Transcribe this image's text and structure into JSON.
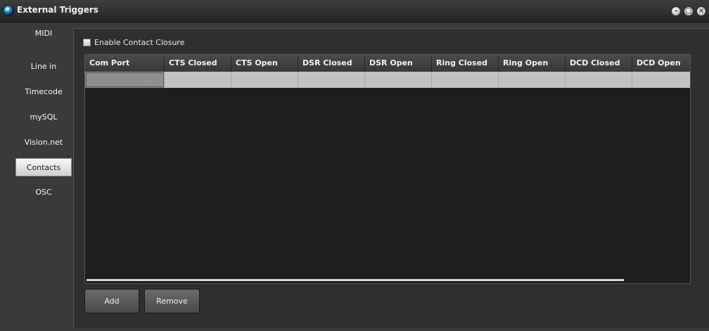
{
  "window": {
    "title": "External Triggers"
  },
  "sidebar": {
    "items": [
      {
        "label": "MIDI",
        "active": false
      },
      {
        "label": "Line in",
        "active": false
      },
      {
        "label": "Timecode",
        "active": false
      },
      {
        "label": "mySQL",
        "active": false
      },
      {
        "label": "Vision.net",
        "active": false
      },
      {
        "label": "Contacts",
        "active": true
      },
      {
        "label": "OSC",
        "active": false
      }
    ]
  },
  "contacts": {
    "enable_label": "Enable Contact Closure",
    "enable_checked": false,
    "columns": [
      "Com Port",
      "CTS Closed",
      "CTS Open",
      "DSR Closed",
      "DSR Open",
      "Ring Closed",
      "Ring Open",
      "DCD Closed",
      "DCD Open"
    ],
    "rows": [
      [
        "",
        "",
        "",
        "",
        "",
        "",
        "",
        "",
        ""
      ]
    ],
    "add_label": "Add",
    "remove_label": "Remove"
  }
}
